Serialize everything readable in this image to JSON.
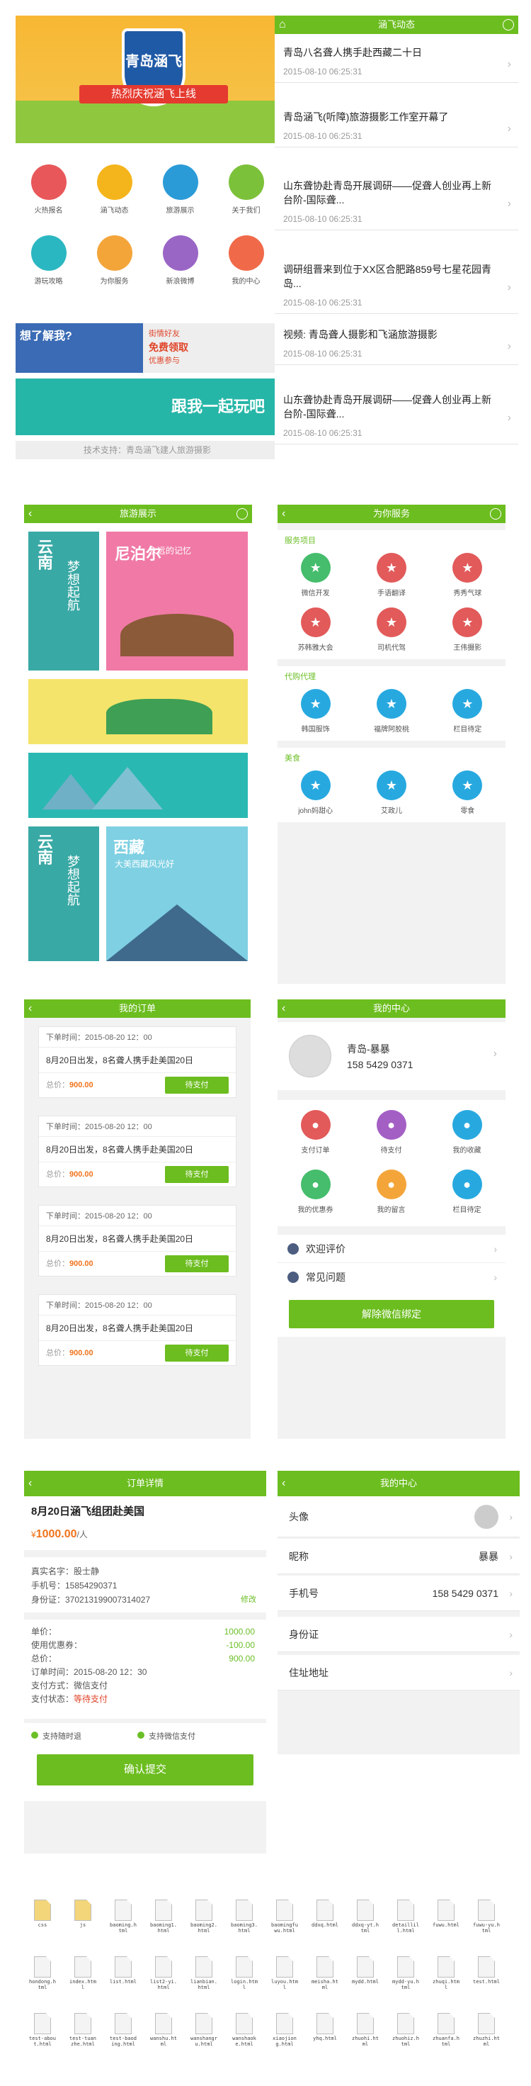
{
  "banner": {
    "logo": "青岛涵飞",
    "ribbon": "热烈庆祝涵飞上线"
  },
  "home_icons": [
    {
      "label": "火热报名",
      "color": "#e8585a",
      "icon": "sound-icon"
    },
    {
      "label": "涵飞动态",
      "color": "#f4b51c",
      "icon": "chat-icon"
    },
    {
      "label": "旅游展示",
      "color": "#2a9bd7",
      "icon": "grid-icon"
    },
    {
      "label": "关于我们",
      "color": "#7cc13a",
      "icon": "home-icon"
    },
    {
      "label": "游玩攻略",
      "color": "#2bb7c1",
      "icon": "bubble-icon"
    },
    {
      "label": "为你服务",
      "color": "#f4a53a",
      "icon": "smile-icon"
    },
    {
      "label": "新浪微博",
      "color": "#9a66c6",
      "icon": "weibo-icon"
    },
    {
      "label": "我的中心",
      "color": "#f06a4a",
      "icon": "user-icon"
    }
  ],
  "promo1": {
    "t1": "想了解我?",
    "t2": "街情好友",
    "t3": "免费领取",
    "t4": "优惠参与"
  },
  "promo2": {
    "t": "跟我一起玩吧"
  },
  "tech_support": "技术支持：青岛涵飞建人旅游摄影",
  "news": {
    "title": "涵飞动态",
    "items": [
      {
        "t": "青岛八名聋人携手赴西藏二十日",
        "d": "2015-08-10 06:25:31"
      },
      {
        "t": "青岛涵飞(听障)旅游摄影工作室开幕了",
        "d": "2015-08-10 06:25:31"
      },
      {
        "t": "山东聋协赴青岛开展调研——促聋人创业再上新台阶-国际聋...",
        "d": "2015-08-10 06:25:31"
      },
      {
        "t": "调研组晋来到位于XX区合肥路859号七星花园青岛...",
        "d": "2015-08-10 06:25:31"
      },
      {
        "t": "视频: 青岛聋人摄影和飞涵旅游摄影",
        "d": "2015-08-10 06:25:31"
      },
      {
        "t": "山东聋协赴青岛开展调研——促聋人创业再上新台阶-国际聋...",
        "d": "2015-08-10 06:25:31"
      }
    ]
  },
  "travel": {
    "title": "旅游展示",
    "cards": [
      {
        "a": "云南",
        "b": "梦想起航"
      },
      {
        "a": "尼泊尔",
        "b": "永远的记忆"
      },
      {
        "a": "西藏",
        "b": "大美西藏风光好"
      },
      {
        "a": "云南",
        "b": "梦想起航"
      }
    ]
  },
  "service": {
    "title": "为你服务",
    "sections": [
      {
        "name": "服务项目",
        "items": [
          {
            "label": "微信开发",
            "color": "#45bd6c"
          },
          {
            "label": "手语翻译",
            "color": "#e25a5a"
          },
          {
            "label": "秀秀气球",
            "color": "#e25a5a"
          },
          {
            "label": "苏韩雅大会",
            "color": "#e25a5a"
          },
          {
            "label": "司机代驾",
            "color": "#e25a5a"
          },
          {
            "label": "王伟摄影",
            "color": "#e25a5a"
          }
        ]
      },
      {
        "name": "代购代理",
        "items": [
          {
            "label": "韩国服饰",
            "color": "#27a9e0"
          },
          {
            "label": "福牌阿胶桃",
            "color": "#27a9e0"
          },
          {
            "label": "栏目待定",
            "color": "#27a9e0"
          }
        ]
      },
      {
        "name": "美食",
        "items": [
          {
            "label": "john妈甜心",
            "color": "#27a9e0"
          },
          {
            "label": "艾政儿",
            "color": "#27a9e0"
          },
          {
            "label": "零食",
            "color": "#27a9e0"
          }
        ]
      }
    ]
  },
  "orders": {
    "title": "我的订单",
    "items": [
      {
        "time": "下单时间：2015-08-20 12：00",
        "desc": "8月20日出发，8名聋人携手赴美国20日",
        "total_label": "总价：",
        "total": "900.00",
        "btn": "待支付"
      },
      {
        "time": "下单时间：2015-08-20 12：00",
        "desc": "8月20日出发，8名聋人携手赴美国20日",
        "total_label": "总价：",
        "total": "900.00",
        "btn": "待支付"
      },
      {
        "time": "下单时间：2015-08-20 12：00",
        "desc": "8月20日出发，8名聋人携手赴美国20日",
        "total_label": "总价：",
        "total": "900.00",
        "btn": "待支付"
      },
      {
        "time": "下单时间：2015-08-20 12：00",
        "desc": "8月20日出发，8名聋人携手赴美国20日",
        "total_label": "总价：",
        "total": "900.00",
        "btn": "待支付"
      }
    ]
  },
  "center": {
    "title": "我的中心",
    "name": "青岛-暴暴",
    "phone": "158 5429 0371",
    "icons": [
      {
        "label": "支付订单",
        "color": "#e25a5a"
      },
      {
        "label": "待支付",
        "color": "#a45fc4"
      },
      {
        "label": "我的收藏",
        "color": "#27a9e0"
      },
      {
        "label": "我的优惠券",
        "color": "#45bd6c"
      },
      {
        "label": "我的留言",
        "color": "#f4a53a"
      },
      {
        "label": "栏目待定",
        "color": "#27a9e0"
      }
    ],
    "links": [
      "欢迎评价",
      "常见问题"
    ],
    "btn": "解除微信绑定"
  },
  "detail": {
    "title": "订单详情",
    "product": "8月20日涵飞组团赴美国",
    "price": "1000.00",
    "unit": "/人",
    "price_prefix": "¥",
    "name_l": "真实名字：股士静",
    "phone_l": "手机号：15854290371",
    "id_l": "身份证：370213199007314027",
    "edit": "修改",
    "lines": [
      {
        "k": "单价：",
        "v": "1000.00"
      },
      {
        "k": "使用优惠券：",
        "v": "-100.00"
      },
      {
        "k": "总价：",
        "v": "900.00"
      }
    ],
    "order_time": "订单时间：2015-08-20 12：30",
    "pay_method": "支付方式：微信支付",
    "pay_status_l": "支付状态：",
    "pay_status": "等待支付",
    "opt1": "支持随时退",
    "opt2": "支持微信支付",
    "btn": "确认提交"
  },
  "profile": {
    "title": "我的中心",
    "rows": [
      {
        "k": "头像",
        "v": ""
      },
      {
        "k": "昵称",
        "v": "暴暴"
      },
      {
        "k": "手机号",
        "v": "158 5429 0371"
      },
      {
        "k": "身份证",
        "v": ""
      },
      {
        "k": "住址地址",
        "v": ""
      }
    ]
  },
  "files": [
    "css",
    "js",
    "baoming.html",
    "baoming1.html",
    "baoming2.html",
    "baoming3.html",
    "baomingfuwu.html",
    "ddxq.html",
    "ddxq-yt.html",
    "detaillill.html",
    "fuwu.html",
    "fuwu-yu.html",
    "hondong.html",
    "index.html",
    "list.html",
    "list2-yi.html",
    "lianbian.html",
    "login.html",
    "luyou.html",
    "meisha.html",
    "mydd.html",
    "mydd-yu.html",
    "zhuqi.html",
    "test.html",
    "test-about.html",
    "test-tuanzhe.html",
    "test-baoding.html",
    "wanshu.html",
    "wanshangru.html",
    "wanshaoke.html",
    "xiaojiong.html",
    "yhq.html",
    "zhuohi.html",
    "zhuohiz.html",
    "zhuanfa.html",
    "zhuzhi.html"
  ]
}
